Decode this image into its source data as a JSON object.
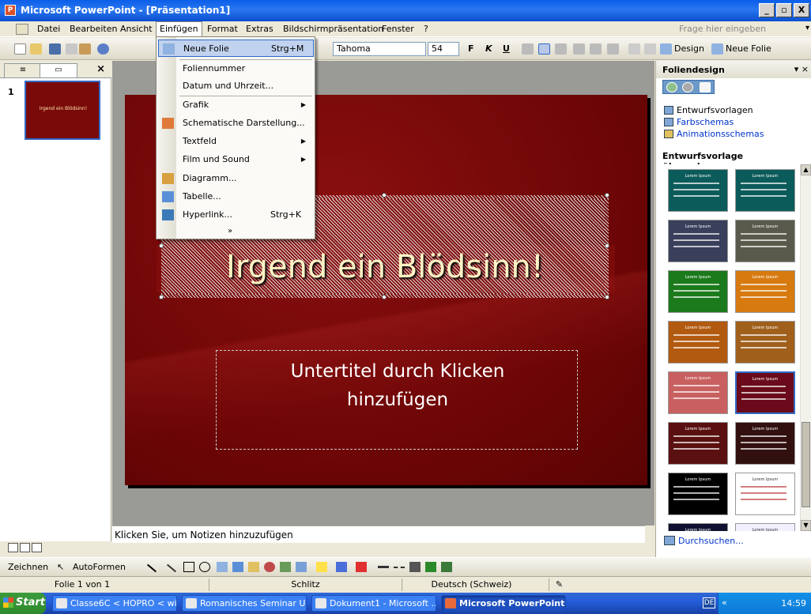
{
  "window": {
    "title": "Microsoft PowerPoint - [Präsentation1]",
    "controls": [
      "_",
      "▫",
      "X"
    ]
  },
  "menu": {
    "items": [
      "Datei",
      "Bearbeiten",
      "Ansicht",
      "Einfügen",
      "Format",
      "Extras",
      "Bildschirmpräsentation",
      "Fenster",
      "?"
    ],
    "active": "Einfügen",
    "help_placeholder": "Frage hier eingeben"
  },
  "toolbar": {
    "font": "Tahoma",
    "size": "54",
    "bold": "F",
    "italic": "K",
    "underline": "U",
    "design_label": "Design",
    "new_slide_label": "Neue Folie"
  },
  "insert_menu": {
    "items": [
      {
        "label": "Neue Folie",
        "shortcut": "Strg+M",
        "icon": "new-slide-icon"
      },
      {
        "label": "Foliennummer",
        "shortcut": "",
        "icon": ""
      },
      {
        "label": "Datum und Uhrzeit...",
        "shortcut": "",
        "icon": ""
      },
      {
        "label": "Grafik",
        "shortcut": "",
        "icon": "",
        "submenu": true
      },
      {
        "label": "Schematische Darstellung...",
        "shortcut": "",
        "icon": "diagram-gallery-icon"
      },
      {
        "label": "Textfeld",
        "shortcut": "",
        "icon": "",
        "submenu": true
      },
      {
        "label": "Film und Sound",
        "shortcut": "",
        "icon": "",
        "submenu": true
      },
      {
        "label": "Diagramm...",
        "shortcut": "",
        "icon": "chart-icon"
      },
      {
        "label": "Tabelle...",
        "shortcut": "",
        "icon": "table-icon"
      },
      {
        "label": "Hyperlink...",
        "shortcut": "Strg+K",
        "icon": "hyperlink-icon"
      }
    ],
    "more": "»"
  },
  "slides_pane": {
    "slide_number": "1",
    "thumb_title": "Irgend ein Blödsinn!"
  },
  "slide": {
    "title": "Irgend ein Blödsinn!",
    "subtitle_line1": "Untertitel durch Klicken",
    "subtitle_line2": "hinzufügen"
  },
  "notes": {
    "placeholder": "Klicken Sie, um Notizen hinzuzufügen"
  },
  "task_pane": {
    "title": "Foliendesign",
    "links": [
      "Entwurfsvorlagen",
      "Farbschemas",
      "Animationsschemas"
    ],
    "section": "Entwurfsvorlage übernehmen:",
    "template_caption": "Lorem Ipsum",
    "browse": "Durchsuchen...",
    "colors": [
      "#0c5b5b",
      "#0c5b5b",
      "#3a3f5c",
      "#5a5a4c",
      "#1b7a1b",
      "#d77a10",
      "#b25a10",
      "#a0601c",
      "#c86060",
      "#6a0a1a",
      "#5a1010",
      "#331010",
      "#000000",
      "#ffffff",
      "#101030",
      "#f0f0ff"
    ]
  },
  "drawing_toolbar": {
    "draw": "Zeichnen",
    "autoshapes": "AutoFormen"
  },
  "status": {
    "slide": "Folie 1 von 1",
    "design": "Schlitz",
    "language": "Deutsch (Schweiz)"
  },
  "taskbar": {
    "start": "Start",
    "tasks": [
      "Classe6C < HOPRO < wi...",
      "Romanisches Seminar Un...",
      "Dokument1 - Microsoft ...",
      "Microsoft PowerPoint ..."
    ],
    "lang": "DE",
    "clock": "14:59"
  }
}
